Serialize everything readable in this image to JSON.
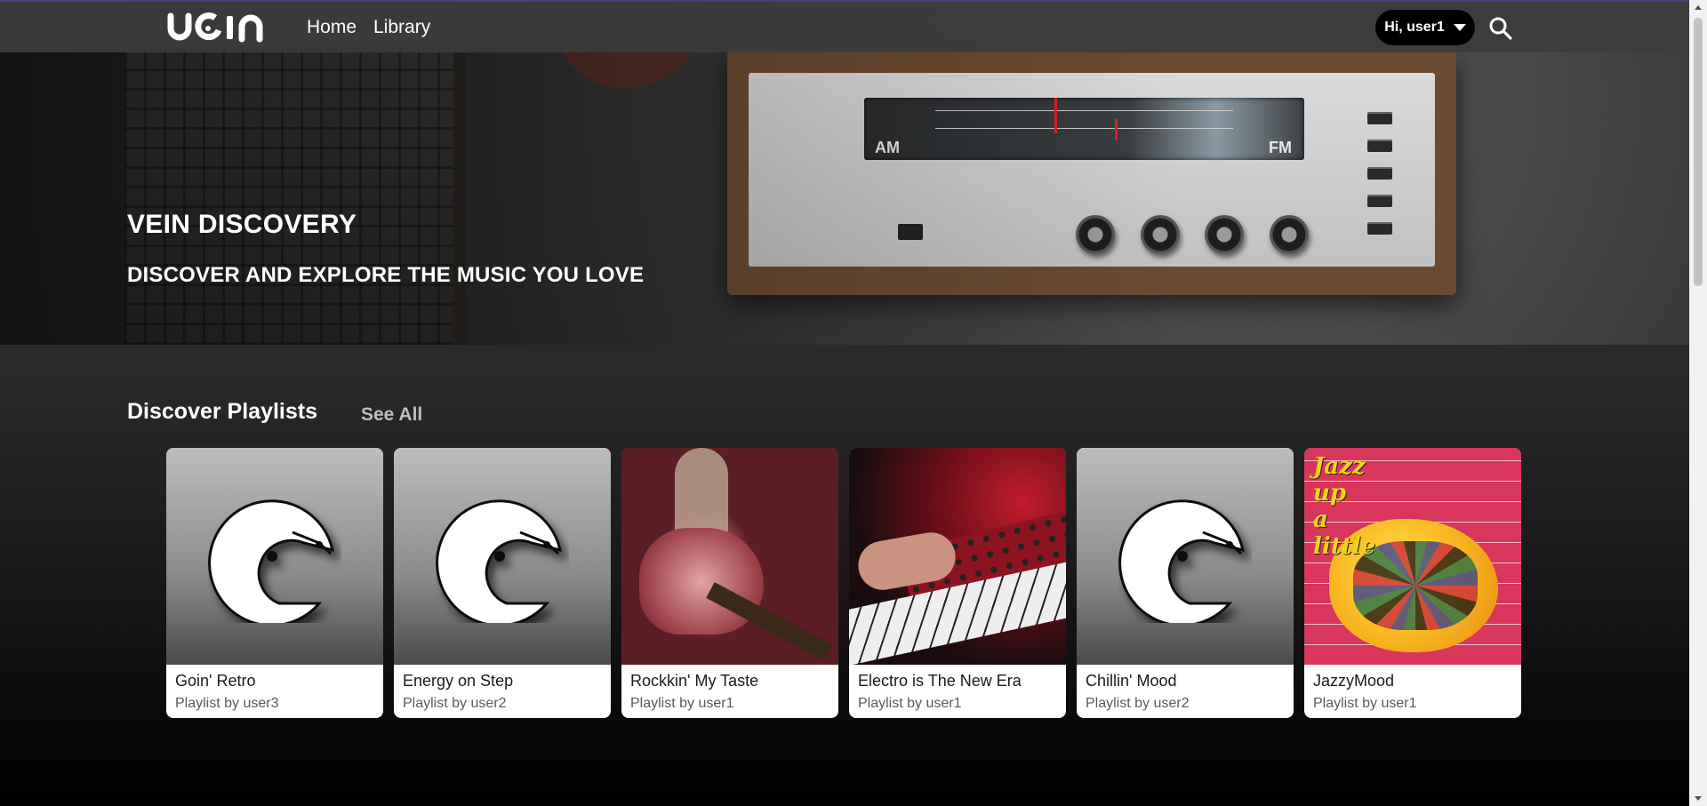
{
  "navbar": {
    "logo_text": "vein",
    "links": [
      {
        "label": "Home"
      },
      {
        "label": "Library"
      }
    ],
    "user_menu_label": "Hi, user1",
    "icons": {
      "caret": "chevron-down-icon",
      "search": "search-icon"
    }
  },
  "hero": {
    "title": "VEIN DISCOVERY",
    "subtitle": "DISCOVER AND EXPLORE THE MUSIC YOU LOVE",
    "radio_labels": {
      "am": "AM",
      "fm": "FM"
    }
  },
  "section": {
    "title": "Discover Playlists",
    "see_all": "See All"
  },
  "playlists": [
    {
      "name": "Goin' Retro",
      "owner": "Playlist by user3",
      "cover": "default-vein-logo"
    },
    {
      "name": "Energy on Step",
      "owner": "Playlist by user2",
      "cover": "default-vein-logo"
    },
    {
      "name": "Rockkin' My Taste",
      "owner": "Playlist by user1",
      "cover": "guitar-photo"
    },
    {
      "name": "Electro is The New Era",
      "owner": "Playlist by user1",
      "cover": "keyboard-photo"
    },
    {
      "name": "Chillin' Mood",
      "owner": "Playlist by user2",
      "cover": "default-vein-logo"
    },
    {
      "name": "JazzyMood",
      "owner": "Playlist by user1",
      "cover": "jazz-artwork",
      "cover_text": "Jazz up a little"
    }
  ],
  "colors": {
    "navbar_bg": "#3c3c3c",
    "accent_border": "#4b3f7a",
    "see_all": "#bdbdbd",
    "card_bg": "#ffffff"
  }
}
